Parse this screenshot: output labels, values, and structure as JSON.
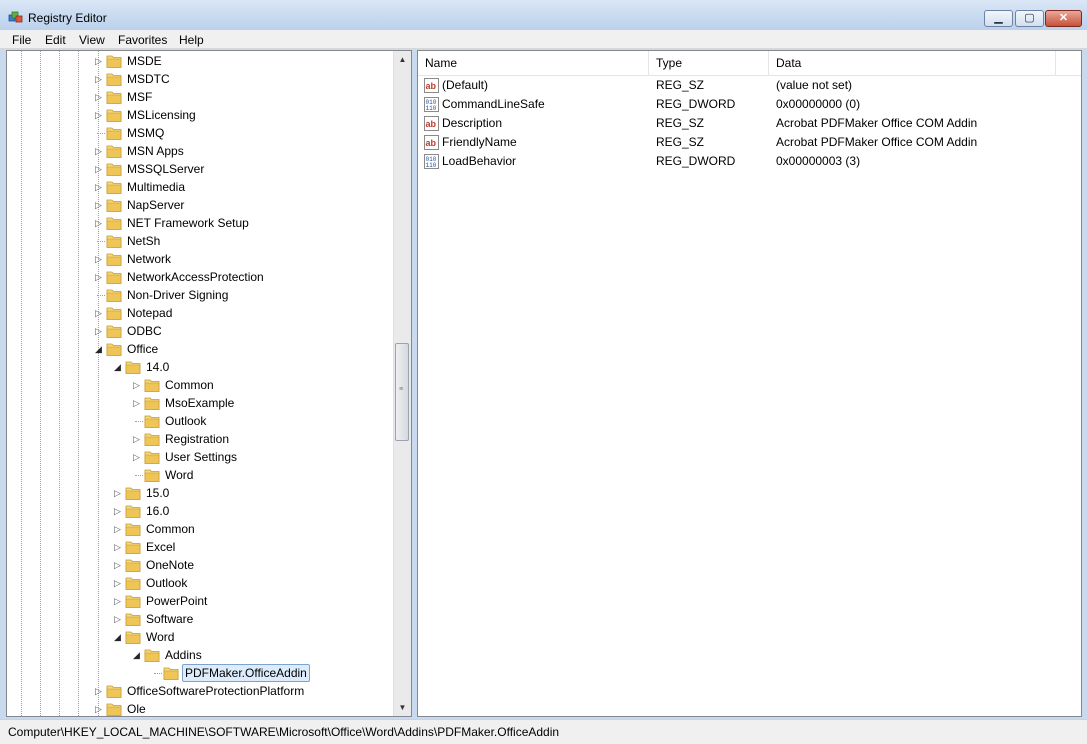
{
  "window": {
    "title": "Registry Editor"
  },
  "title_buttons": {
    "minimize": "▁",
    "maximize": "▢",
    "close": "✕"
  },
  "menu": [
    "File",
    "Edit",
    "View",
    "Favorites",
    "Help"
  ],
  "tree": {
    "rows": [
      {
        "label": "MSDE",
        "depth": 0,
        "state": "collapsed"
      },
      {
        "label": "MSDTC",
        "depth": 0,
        "state": "collapsed"
      },
      {
        "label": "MSF",
        "depth": 0,
        "state": "collapsed"
      },
      {
        "label": "MSLicensing",
        "depth": 0,
        "state": "collapsed"
      },
      {
        "label": "MSMQ",
        "depth": 0,
        "state": "leaf"
      },
      {
        "label": "MSN Apps",
        "depth": 0,
        "state": "collapsed"
      },
      {
        "label": "MSSQLServer",
        "depth": 0,
        "state": "collapsed"
      },
      {
        "label": "Multimedia",
        "depth": 0,
        "state": "collapsed"
      },
      {
        "label": "NapServer",
        "depth": 0,
        "state": "collapsed"
      },
      {
        "label": "NET Framework Setup",
        "depth": 0,
        "state": "collapsed"
      },
      {
        "label": "NetSh",
        "depth": 0,
        "state": "leaf"
      },
      {
        "label": "Network",
        "depth": 0,
        "state": "collapsed"
      },
      {
        "label": "NetworkAccessProtection",
        "depth": 0,
        "state": "collapsed"
      },
      {
        "label": "Non-Driver Signing",
        "depth": 0,
        "state": "leaf"
      },
      {
        "label": "Notepad",
        "depth": 0,
        "state": "collapsed"
      },
      {
        "label": "ODBC",
        "depth": 0,
        "state": "collapsed"
      },
      {
        "label": "Office",
        "depth": 0,
        "state": "expanded"
      },
      {
        "label": "14.0",
        "depth": 1,
        "state": "expanded"
      },
      {
        "label": "Common",
        "depth": 2,
        "state": "collapsed"
      },
      {
        "label": "MsoExample",
        "depth": 2,
        "state": "collapsed"
      },
      {
        "label": "Outlook",
        "depth": 2,
        "state": "leaf"
      },
      {
        "label": "Registration",
        "depth": 2,
        "state": "collapsed"
      },
      {
        "label": "User Settings",
        "depth": 2,
        "state": "collapsed"
      },
      {
        "label": "Word",
        "depth": 2,
        "state": "leaf"
      },
      {
        "label": "15.0",
        "depth": 1,
        "state": "collapsed"
      },
      {
        "label": "16.0",
        "depth": 1,
        "state": "collapsed"
      },
      {
        "label": "Common",
        "depth": 1,
        "state": "collapsed"
      },
      {
        "label": "Excel",
        "depth": 1,
        "state": "collapsed"
      },
      {
        "label": "OneNote",
        "depth": 1,
        "state": "collapsed"
      },
      {
        "label": "Outlook",
        "depth": 1,
        "state": "collapsed"
      },
      {
        "label": "PowerPoint",
        "depth": 1,
        "state": "collapsed"
      },
      {
        "label": "Software",
        "depth": 1,
        "state": "collapsed"
      },
      {
        "label": "Word",
        "depth": 1,
        "state": "expanded"
      },
      {
        "label": "Addins",
        "depth": 2,
        "state": "expanded"
      },
      {
        "label": "PDFMaker.OfficeAddin",
        "depth": 3,
        "state": "leaf",
        "selected": true
      },
      {
        "label": "OfficeSoftwareProtectionPlatform",
        "depth": 0,
        "state": "collapsed"
      },
      {
        "label": "Ole",
        "depth": 0,
        "state": "collapsed"
      }
    ]
  },
  "list": {
    "columns": [
      "Name",
      "Type",
      "Data"
    ],
    "rows": [
      {
        "name": "(Default)",
        "type": "REG_SZ",
        "data": "(value not set)",
        "icon": "string-value-icon"
      },
      {
        "name": "CommandLineSafe",
        "type": "REG_DWORD",
        "data": "0x00000000 (0)",
        "icon": "binary-value-icon"
      },
      {
        "name": "Description",
        "type": "REG_SZ",
        "data": "Acrobat PDFMaker Office COM Addin",
        "icon": "string-value-icon"
      },
      {
        "name": "FriendlyName",
        "type": "REG_SZ",
        "data": "Acrobat PDFMaker Office COM Addin",
        "icon": "string-value-icon"
      },
      {
        "name": "LoadBehavior",
        "type": "REG_DWORD",
        "data": "0x00000003 (3)",
        "icon": "binary-value-icon"
      }
    ]
  },
  "status": {
    "path": "Computer\\HKEY_LOCAL_MACHINE\\SOFTWARE\\Microsoft\\Office\\Word\\Addins\\PDFMaker.OfficeAddin"
  },
  "colors": {
    "selection_bg": "#ddecfd",
    "selection_border": "#7da2ce",
    "folder": "#e8c25a"
  }
}
